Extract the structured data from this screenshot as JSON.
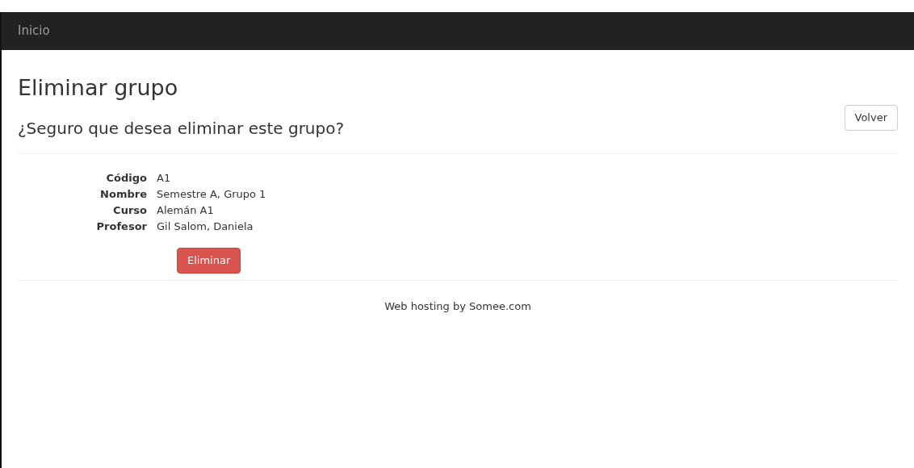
{
  "navbar": {
    "brand": "Inicio"
  },
  "page": {
    "title": "Eliminar grupo",
    "back_button": "Volver",
    "question": "¿Seguro que desea eliminar este grupo?"
  },
  "details": [
    {
      "label": "Código",
      "value": "A1"
    },
    {
      "label": "Nombre",
      "value": "Semestre A, Grupo 1"
    },
    {
      "label": "Curso",
      "value": "Alemán A1"
    },
    {
      "label": "Profesor",
      "value": "Gil Salom, Daniela"
    }
  ],
  "delete_button": "Eliminar",
  "footer": "Web hosting by Somee.com"
}
